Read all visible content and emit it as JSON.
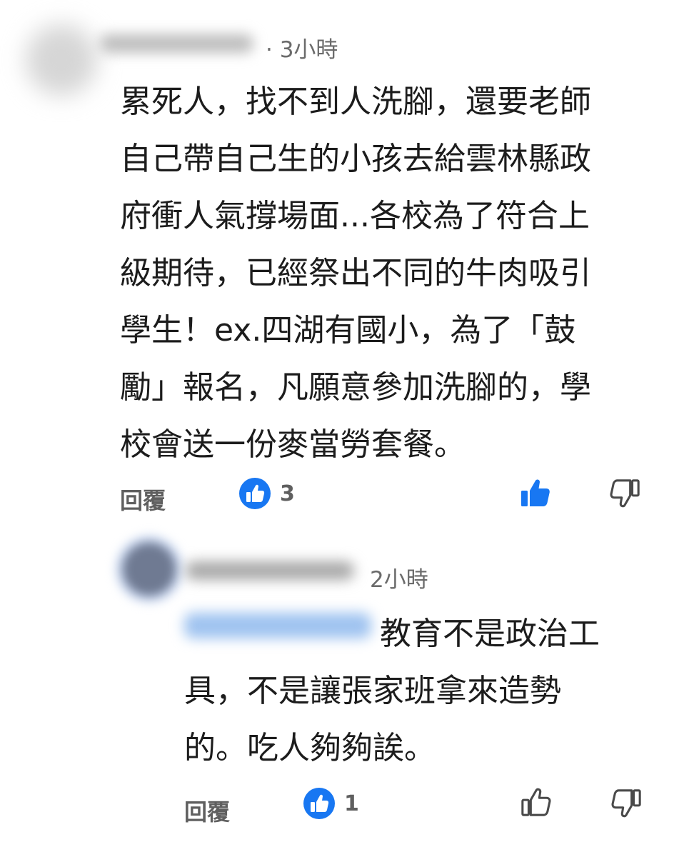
{
  "comment": {
    "time": "· 3小時",
    "body_lines": [
      "累死人，找不到人洗腳，還要老師",
      "自己帶自己生的小孩去給雲林縣政",
      "府衝人氣撐場面...各校為了符合上",
      "級期待，已經祭出不同的牛肉吸引",
      "學生！ex.四湖有國小，為了「鼓",
      "勵」報名，凡願意參加洗腳的，學",
      "校會送一份麥當勞套餐。"
    ],
    "reply_label": "回覆",
    "like_count": "3",
    "liked": true,
    "like_icon": "thumbs-up-icon",
    "dislike_icon": "thumbs-down-icon"
  },
  "reply": {
    "time": "2小時",
    "body_first_line": "教育不是政治工",
    "body_lines": [
      "具，不是讓張家班拿來造勢",
      "的。吃人夠夠誒。"
    ],
    "reply_label": "回覆",
    "like_count": "1",
    "liked": false,
    "like_icon": "thumbs-up-icon",
    "dislike_icon": "thumbs-down-icon"
  },
  "colors": {
    "accent_blue": "#1877f2",
    "text": "#1c1c1c",
    "muted": "#5f5f5f"
  }
}
